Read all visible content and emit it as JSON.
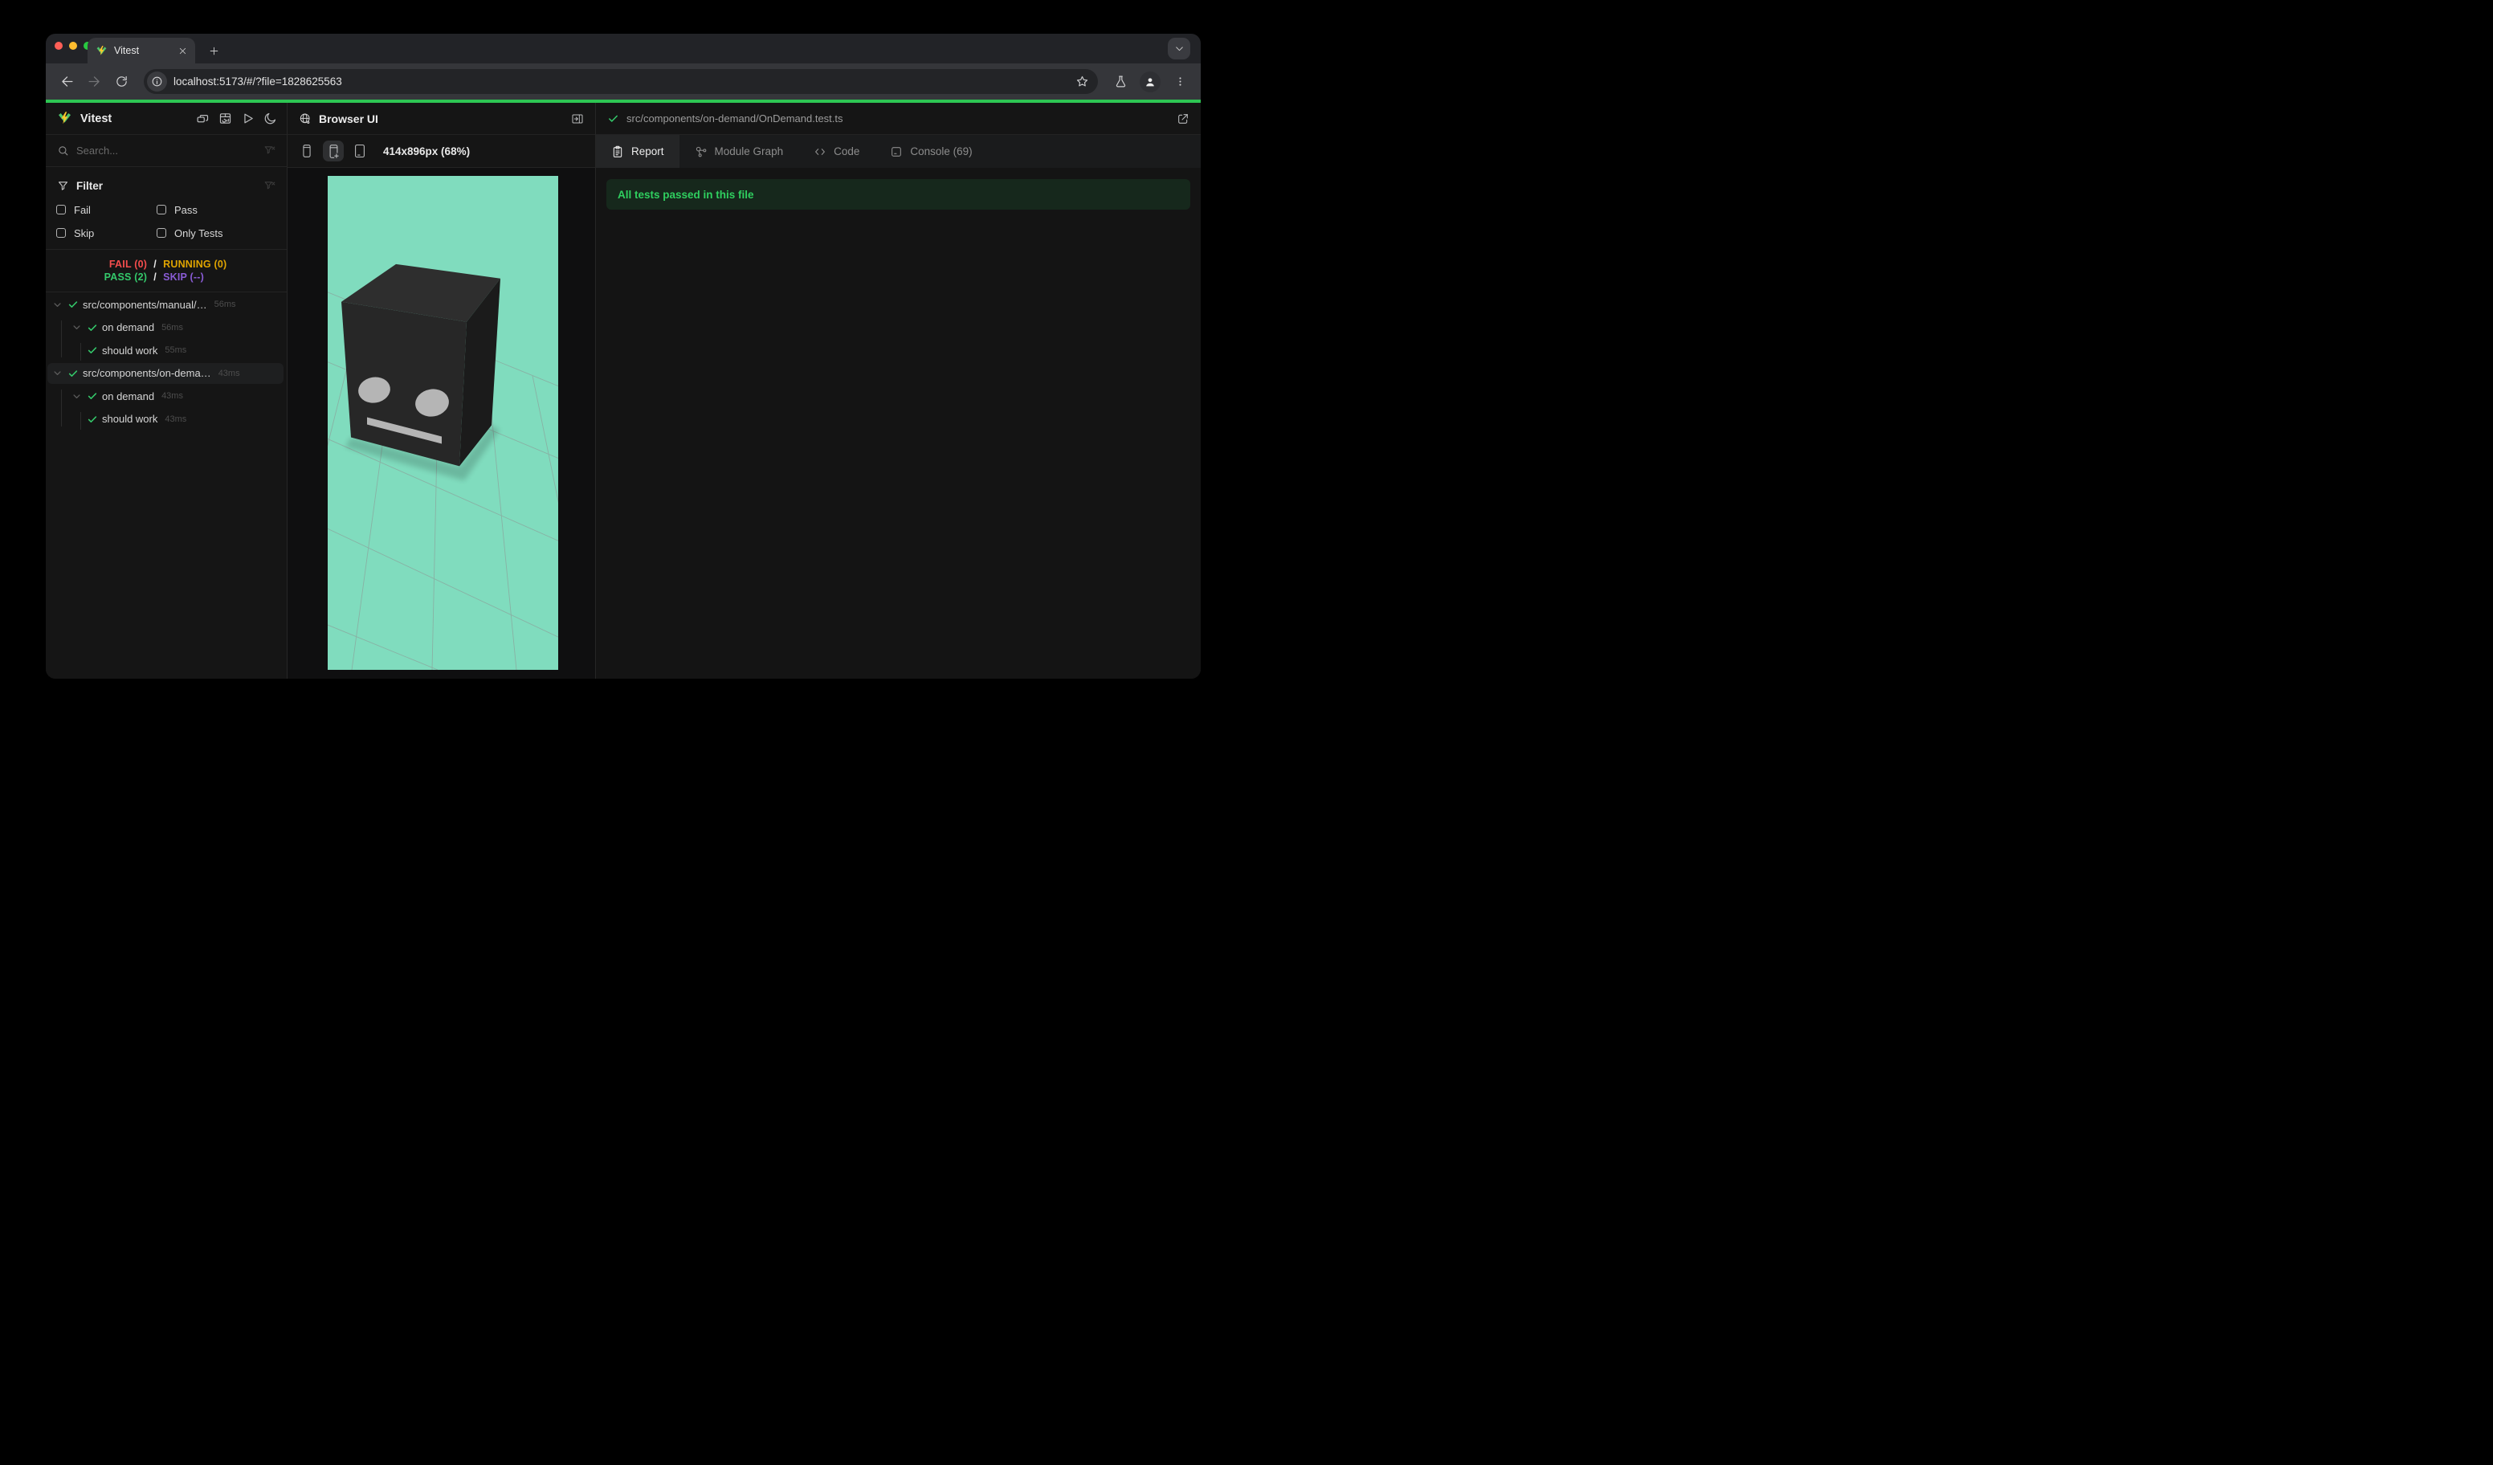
{
  "browser": {
    "tab_title": "Vitest",
    "url": "localhost:5173/#/?file=1828625563",
    "icons": {
      "traffic_lights": [
        "close-red",
        "minimize-yellow",
        "zoom-green"
      ],
      "tab": [
        "vitest-favicon",
        "close-icon",
        "new-tab-plus-icon",
        "tab-search-chevron-icon"
      ],
      "toolbar": [
        "back-arrow-icon",
        "forward-arrow-icon",
        "reload-icon",
        "info-icon",
        "bookmark-star-icon",
        "flask-icon",
        "profile-avatar-icon",
        "kebab-menu-icon"
      ]
    }
  },
  "sidebar": {
    "app_title": "Vitest",
    "header_icons": [
      "stacked-windows-icon",
      "dashboard-icon",
      "run-all-play-icon",
      "dark-mode-moon-icon"
    ],
    "search": {
      "placeholder": "Search...",
      "icons": [
        "search-icon",
        "clear-filter-icon"
      ]
    },
    "filter": {
      "title": "Filter",
      "icons": [
        "funnel-icon",
        "clear-filter-icon"
      ],
      "options": [
        {
          "label": "Fail",
          "checked": false
        },
        {
          "label": "Pass",
          "checked": false
        },
        {
          "label": "Skip",
          "checked": false
        },
        {
          "label": "Only Tests",
          "checked": false
        }
      ]
    },
    "status": {
      "fail": "FAIL (0)",
      "running": "RUNNING (0)",
      "pass": "PASS (2)",
      "skip": "SKIP (--)",
      "separator": "/"
    },
    "tree": {
      "items": [
        {
          "label": "src/components/manual/…",
          "duration": "56ms",
          "level": 0,
          "chevron": true,
          "state": "pass",
          "selected": false
        },
        {
          "label": "on demand",
          "duration": "56ms",
          "level": 1,
          "chevron": true,
          "state": "pass",
          "selected": false
        },
        {
          "label": "should work",
          "duration": "55ms",
          "level": 2,
          "chevron": false,
          "state": "pass",
          "selected": false
        },
        {
          "label": "src/components/on-dema…",
          "duration": "43ms",
          "level": 0,
          "chevron": true,
          "state": "pass",
          "selected": true
        },
        {
          "label": "on demand",
          "duration": "43ms",
          "level": 1,
          "chevron": true,
          "state": "pass",
          "selected": false
        },
        {
          "label": "should work",
          "duration": "43ms",
          "level": 2,
          "chevron": false,
          "state": "pass",
          "selected": false
        }
      ]
    }
  },
  "browser_panel": {
    "title": "Browser UI",
    "title_icon": "globe-icon",
    "dock_icon": "dock-panel-right-icon",
    "device_buttons": [
      "device-phone-small-icon",
      "device-phone-add-icon",
      "device-tablet-icon"
    ],
    "active_device_index": 1,
    "viewport_label": "414x896px (68%)",
    "scene": {
      "description": "3D dark cube robot head with two gray eyes and a mouth bar on a mint floor grid",
      "background": "#80dcbe",
      "cube_color": "#272727",
      "face_feature_color": "#b5b5b5"
    }
  },
  "report_panel": {
    "file_check_icon": "pass-check-icon",
    "file_path": "src/components/on-demand/OnDemand.test.ts",
    "open_external_icon": "external-link-icon",
    "tabs": [
      {
        "label": "Report",
        "icon": "report-clipboard-icon",
        "active": true
      },
      {
        "label": "Module Graph",
        "icon": "module-graph-icon",
        "active": false
      },
      {
        "label": "Code",
        "icon": "code-icon",
        "active": false
      },
      {
        "label": "Console (69)",
        "icon": "console-icon",
        "active": false
      }
    ],
    "banner": "All tests passed in this file"
  },
  "colors": {
    "accent_green": "#2dc653",
    "pass_green": "#34c96b",
    "fail_red": "#f44d4d",
    "running_yellow": "#dfa400",
    "skip_purple": "#8a5cd6",
    "banner_bg": "#16281c",
    "banner_text": "#2fcf5f",
    "mint": "#80dcbe"
  }
}
